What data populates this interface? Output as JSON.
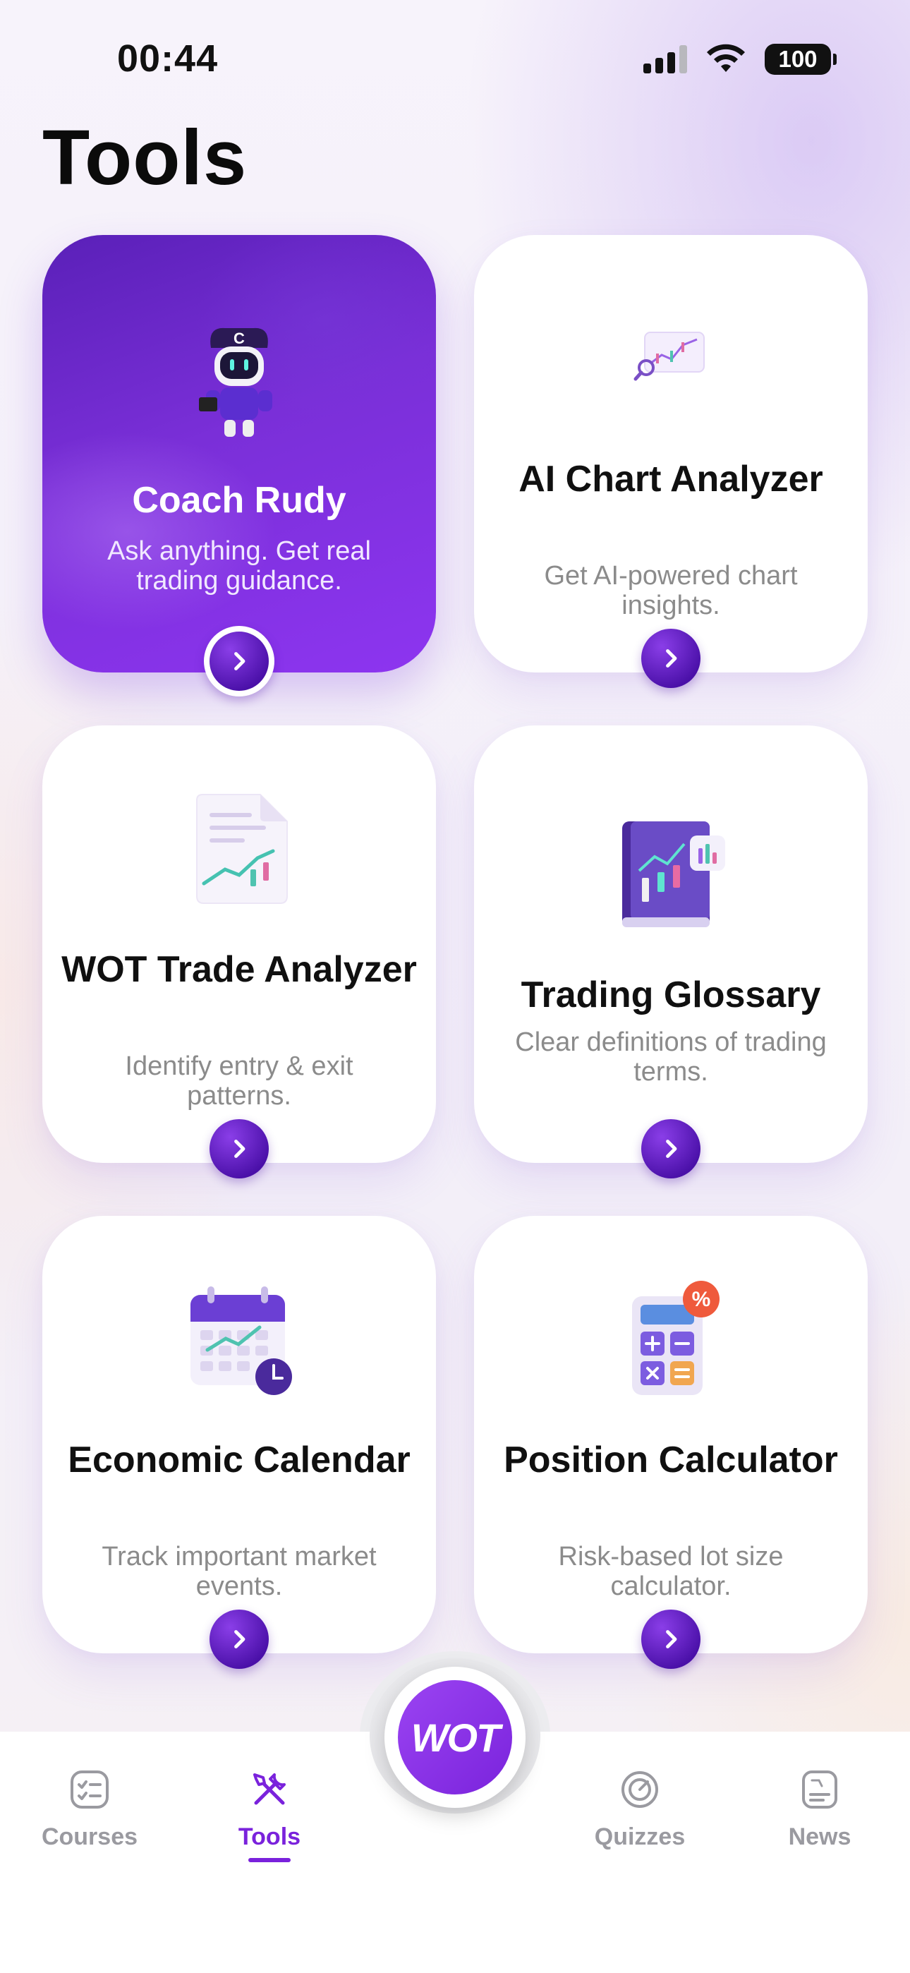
{
  "status_bar": {
    "time": "00:44",
    "battery": "100"
  },
  "page_title": "Tools",
  "cards": [
    {
      "title": "Coach Rudy",
      "description": "Ask anything. Get real trading guidance."
    },
    {
      "title": "AI Chart Analyzer",
      "description": "Get AI-powered chart insights."
    },
    {
      "title": "WOT Trade Analyzer",
      "description": "Identify entry & exit patterns."
    },
    {
      "title": "Trading Glossary",
      "description": "Clear definitions of trading terms."
    },
    {
      "title": "Economic Calendar",
      "description": "Track important market events."
    },
    {
      "title": "Position Calculator",
      "description": "Risk-based lot size calculator."
    }
  ],
  "nav": {
    "items": [
      {
        "label": "Courses",
        "icon": "checklist-icon"
      },
      {
        "label": "Tools",
        "icon": "tools-icon",
        "active": true
      },
      {
        "label": "Quizzes",
        "icon": "quiz-icon"
      },
      {
        "label": "News",
        "icon": "news-icon"
      }
    ],
    "center_logo": "WOT"
  },
  "colors": {
    "accent": "#7a22dc",
    "inactive": "#9a9aa0"
  }
}
